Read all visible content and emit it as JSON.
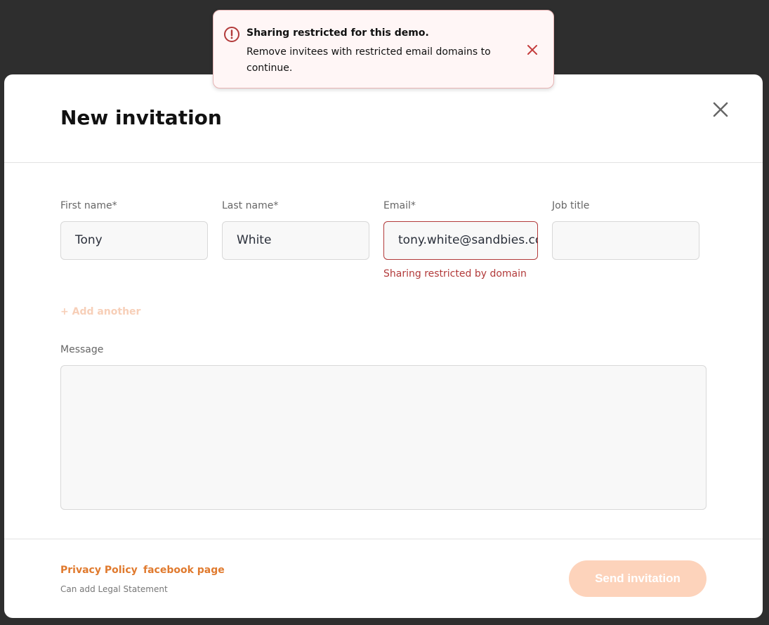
{
  "toast": {
    "title": "Sharing restricted for this demo.",
    "message": "Remove invitees with restricted email domains to continue.",
    "icon": "alert-circle-icon",
    "color": "#b23a3a"
  },
  "modal": {
    "title": "New invitation",
    "fields": [
      {
        "label": "First name*",
        "value": "Tony"
      },
      {
        "label": "Last name*",
        "value": "White"
      },
      {
        "label": "Email*",
        "value": "tony.white@sandbies.com",
        "error": "Sharing restricted by domain"
      },
      {
        "label": "Job title",
        "value": ""
      }
    ],
    "add_another": "+ Add another",
    "message_label": "Message",
    "message_value": "",
    "footer": {
      "privacy": "Privacy Policy",
      "facebook": "facebook page",
      "legal": "Can add Legal Statement",
      "send": "Send invitation"
    },
    "accent": "#e07a2e"
  }
}
